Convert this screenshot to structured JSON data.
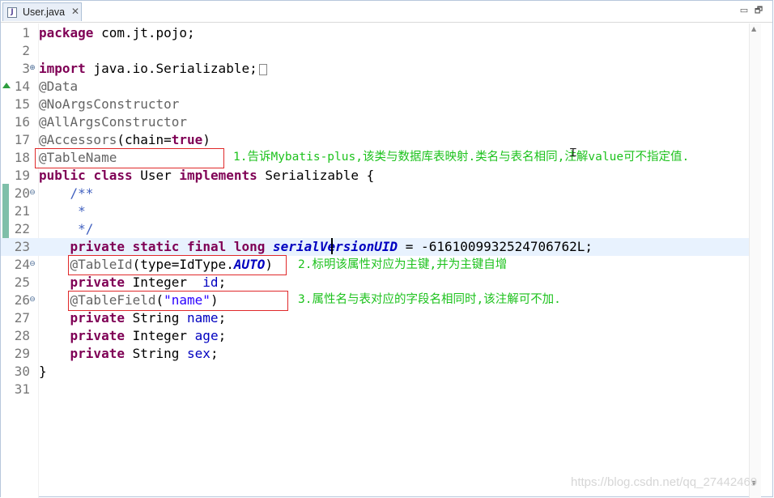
{
  "tab": {
    "title": "User.java",
    "close_label": "✕",
    "icon_letter": "J"
  },
  "window_controls": {
    "minimize": "▭",
    "maximize": "🗗"
  },
  "code_lines": [
    {
      "num": "1"
    },
    {
      "num": "2"
    },
    {
      "num": "3"
    },
    {
      "num": "14"
    },
    {
      "num": "15"
    },
    {
      "num": "16"
    },
    {
      "num": "17"
    },
    {
      "num": "18"
    },
    {
      "num": "19"
    },
    {
      "num": "20"
    },
    {
      "num": "21"
    },
    {
      "num": "22"
    },
    {
      "num": "23"
    },
    {
      "num": "24"
    },
    {
      "num": "25"
    },
    {
      "num": "26"
    },
    {
      "num": "27"
    },
    {
      "num": "28"
    },
    {
      "num": "29"
    },
    {
      "num": "30"
    },
    {
      "num": "31"
    }
  ],
  "code": {
    "l1_kw": "package",
    "l1_rest": " com.jt.pojo;",
    "l3_kw": "import",
    "l3_rest": " java.io.Serializable;",
    "l14": "@Data",
    "l15": "@NoArgsConstructor",
    "l16": "@AllArgsConstructor",
    "l17_ann": "@Accessors",
    "l17_a": "(chain=",
    "l17_kw": "true",
    "l17_b": ")",
    "l18": "@TableName",
    "l19_kw1": "public",
    "l19_kw2": "class",
    "l19_name": " User ",
    "l19_kw3": "implements",
    "l19_rest": " Serializable {",
    "l20": "    /**",
    "l21": "     *",
    "l22": "     */",
    "l23_kw1": "private",
    "l23_kw2": "static",
    "l23_kw3": "final",
    "l23_kw4": "long",
    "l23_field": "serialVersionUID",
    "l23_rest": " = -6161009932524706762L;",
    "l24_ann": "@TableId",
    "l24_a": "(type=IdType.",
    "l24_const": "AUTO",
    "l24_b": ")",
    "l25_kw": "private",
    "l25_type": " Integer  ",
    "l25_field": "id",
    "l25_end": ";",
    "l26_ann": "@TableField",
    "l26_a": "(",
    "l26_str": "\"name\"",
    "l26_b": ")",
    "l27_kw": "private",
    "l27_type": " String ",
    "l27_field": "name",
    "l27_end": ";",
    "l28_kw": "private",
    "l28_type": " Integer ",
    "l28_field": "age",
    "l28_end": ";",
    "l29_kw": "private",
    "l29_type": " String ",
    "l29_field": "sex",
    "l29_end": ";",
    "l30": "}"
  },
  "notes": {
    "n1": "1.告诉Mybatis-plus,该类与数据库表映射.类名与表名相同,注解value可不指定值.",
    "n2": "2.标明该属性对应为主键,并为主键自增",
    "n3": "3.属性名与表对应的字段名相同时,该注解可不加."
  },
  "watermark": "https://blog.csdn.net/qq_27442469",
  "colors": {
    "keyword": "#7f0055",
    "annotation": "#646464",
    "field": "#0000c0",
    "string": "#2a00ff",
    "note": "#1dc21d",
    "highlight_box": "#e0292a",
    "current_line": "#e8f2fe"
  }
}
